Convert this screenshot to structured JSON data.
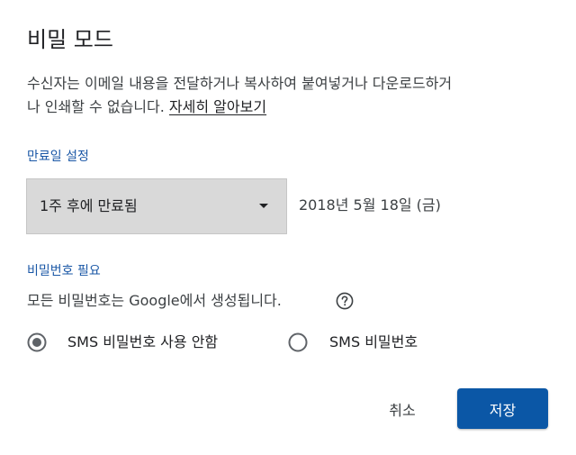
{
  "dialog": {
    "title": "비밀 모드",
    "description_line1": "수신자는 이메일 내용을 전달하거나 복사하여 붙여넣거나 다운로드하거",
    "description_line2": "나 인쇄할 수 없습니다. ",
    "learn_more": "자세히 알아보기"
  },
  "expiry": {
    "label": "만료일 설정",
    "selected_option": "1주 후에 만료됨",
    "date": "2018년 5월 18일 (금)"
  },
  "passcode": {
    "label": "비밀번호 필요",
    "description": "모든 비밀번호는 Google에서 생성됩니다.",
    "options": [
      {
        "label": "SMS 비밀번호 사용 안함",
        "selected": true
      },
      {
        "label": "SMS 비밀번호",
        "selected": false
      }
    ]
  },
  "actions": {
    "cancel_label": "취소",
    "save_label": "저장"
  },
  "colors": {
    "accent_blue": "#0b57a6",
    "label_blue": "#1a57a6",
    "dropdown_bg": "#d9d9d9",
    "radio_gray": "#5f6368"
  },
  "icons": {
    "help": "help-circle-icon",
    "dropdown_caret": "caret-down-icon"
  }
}
